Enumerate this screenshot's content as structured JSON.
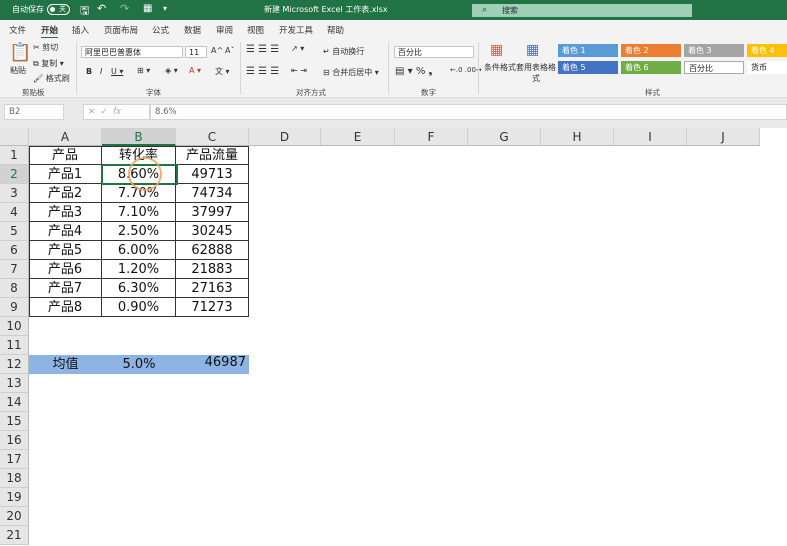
{
  "titlebar": {
    "autosave": "自动保存",
    "toggle": "关",
    "filename": "新建 Microsoft Excel 工作表.xlsx",
    "search": "搜索"
  },
  "tabs": [
    "文件",
    "开始",
    "插入",
    "页面布局",
    "公式",
    "数据",
    "审阅",
    "视图",
    "开发工具",
    "帮助"
  ],
  "ribbon": {
    "clipboard": {
      "paste": "粘贴",
      "cut": "剪切",
      "copy": "复制",
      "format_painter": "格式刷",
      "label": "剪贴板"
    },
    "font": {
      "name": "阿里巴巴普惠体",
      "size": "11",
      "label": "字体"
    },
    "alignment": {
      "wrap": "自动换行",
      "merge": "合并后居中",
      "label": "对齐方式"
    },
    "number": {
      "format": "百分比",
      "label": "数字"
    },
    "styles": {
      "conditional": "条件格式",
      "table": "套用表格格式",
      "label": "样式",
      "cells": [
        {
          "text": "着色 1",
          "color": "#5b9bd5"
        },
        {
          "text": "着色 2",
          "color": "#ed7d31"
        },
        {
          "text": "着色 3",
          "color": "#a5a5a5"
        },
        {
          "text": "着色 4",
          "color": "#ffc000"
        },
        {
          "text": "着色 5",
          "color": "#4472c4"
        },
        {
          "text": "着色 6",
          "color": "#70ad47"
        },
        {
          "text": "百分比",
          "color": "#ffffff"
        },
        {
          "text": "货币",
          "color": "#ffffff"
        }
      ]
    }
  },
  "formula_bar": {
    "name_box": "B2",
    "formula": "8.6%"
  },
  "sheet": {
    "columns": [
      "A",
      "B",
      "C",
      "D",
      "E",
      "F",
      "G",
      "H",
      "I",
      "J"
    ],
    "selected_cell": "B2",
    "rows": [
      [
        "产品",
        "转化率",
        "产品流量"
      ],
      [
        "产品1",
        "8.60%",
        "49713"
      ],
      [
        "产品2",
        "7.70%",
        "74734"
      ],
      [
        "产品3",
        "7.10%",
        "37997"
      ],
      [
        "产品4",
        "2.50%",
        "30245"
      ],
      [
        "产品5",
        "6.00%",
        "62888"
      ],
      [
        "产品6",
        "1.20%",
        "21883"
      ],
      [
        "产品7",
        "6.30%",
        "27163"
      ],
      [
        "产品8",
        "0.90%",
        "71273"
      ]
    ],
    "average": {
      "label": "均值",
      "rate": "5.0%",
      "traffic": "46987",
      "color": "#8db4e2"
    },
    "row_count": 21
  }
}
